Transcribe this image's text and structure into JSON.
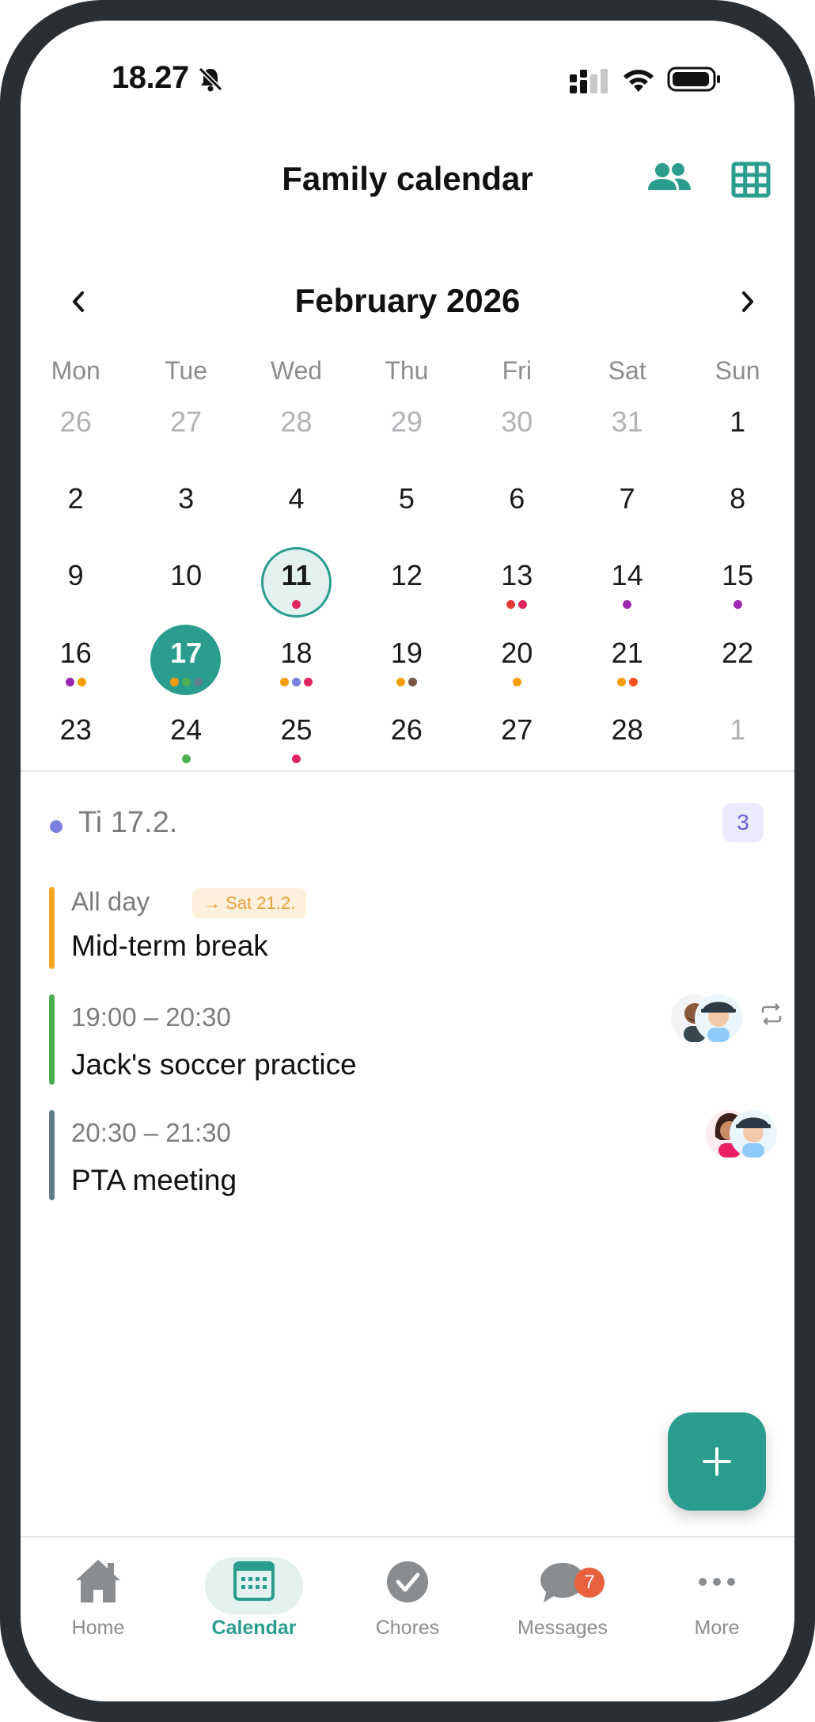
{
  "status_bar": {
    "time": "18.27"
  },
  "header": {
    "title": "Family calendar"
  },
  "month_nav": {
    "title": "February 2026",
    "prev": "‹",
    "next": "›"
  },
  "weekdays": [
    "Mon",
    "Tue",
    "Wed",
    "Thu",
    "Fri",
    "Sat",
    "Sun"
  ],
  "colors": {
    "accent": "#2a9d8f",
    "today_bg": "#e3f2ef",
    "badge": "#e8603c"
  },
  "calendar_weeks": [
    [
      {
        "day": "26",
        "other": true,
        "dots": []
      },
      {
        "day": "27",
        "other": true,
        "dots": []
      },
      {
        "day": "28",
        "other": true,
        "dots": []
      },
      {
        "day": "29",
        "other": true,
        "dots": []
      },
      {
        "day": "30",
        "other": true,
        "dots": []
      },
      {
        "day": "31",
        "other": true,
        "dots": []
      },
      {
        "day": "1",
        "dots": []
      }
    ],
    [
      {
        "day": "2",
        "dots": []
      },
      {
        "day": "3",
        "dots": []
      },
      {
        "day": "4",
        "dots": []
      },
      {
        "day": "5",
        "dots": []
      },
      {
        "day": "6",
        "dots": []
      },
      {
        "day": "7",
        "dots": []
      },
      {
        "day": "8",
        "dots": []
      }
    ],
    [
      {
        "day": "9",
        "dots": []
      },
      {
        "day": "10",
        "dots": []
      },
      {
        "day": "11",
        "today": true,
        "dots": [
          "#e0245e"
        ]
      },
      {
        "day": "12",
        "dots": []
      },
      {
        "day": "13",
        "dots": [
          "#e53935",
          "#e0245e"
        ]
      },
      {
        "day": "14",
        "dots": [
          "#9c27b0"
        ]
      },
      {
        "day": "15",
        "dots": [
          "#9c27b0"
        ]
      }
    ],
    [
      {
        "day": "16",
        "dots": [
          "#9c27b0",
          "#f59e0b"
        ]
      },
      {
        "day": "17",
        "selected": true,
        "dots": [
          "#f59e0b",
          "#4caf50",
          "#607d8b"
        ]
      },
      {
        "day": "18",
        "dots": [
          "#f59e0b",
          "#7b7fe0",
          "#e0245e"
        ]
      },
      {
        "day": "19",
        "dots": [
          "#f59e0b",
          "#795548"
        ]
      },
      {
        "day": "20",
        "dots": [
          "#f59e0b"
        ]
      },
      {
        "day": "21",
        "dots": [
          "#f59e0b",
          "#f4511e"
        ]
      },
      {
        "day": "22",
        "dots": []
      }
    ],
    [
      {
        "day": "23",
        "dots": []
      },
      {
        "day": "24",
        "dots": [
          "#4caf50"
        ]
      },
      {
        "day": "25",
        "dots": [
          "#e0245e"
        ]
      },
      {
        "day": "26",
        "dots": []
      },
      {
        "day": "27",
        "dots": []
      },
      {
        "day": "28",
        "dots": []
      },
      {
        "day": "1",
        "other": true,
        "dots": []
      }
    ]
  ],
  "selected_day": {
    "label": "Ti 17.2.",
    "count": "3"
  },
  "events": [
    {
      "time": "All day",
      "chip": "→ Sat 21.2.",
      "title": "Mid-term break",
      "color": "#f5a623"
    },
    {
      "time": "19:00 – 20:30",
      "title": "Jack's soccer practice",
      "color": "#4caf50",
      "repeat": true
    },
    {
      "time": "20:30 – 21:30",
      "title": "PTA meeting",
      "color": "#607d8b"
    }
  ],
  "bottom_nav": {
    "items": [
      {
        "label": "Home",
        "icon": "home-icon"
      },
      {
        "label": "Calendar",
        "icon": "calendar-icon",
        "active": true
      },
      {
        "label": "Chores",
        "icon": "check-circle-icon"
      },
      {
        "label": "Messages",
        "icon": "chat-bubble-icon",
        "badge": "7"
      },
      {
        "label": "More",
        "icon": "more-dots-icon"
      }
    ]
  }
}
